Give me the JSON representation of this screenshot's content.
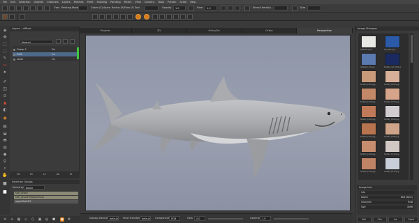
{
  "menu": [
    "File",
    "Edit",
    "Selection",
    "Objects",
    "Channels",
    "Layers",
    "Patches",
    "Paint",
    "Shading",
    "Painting",
    "Filters",
    "View",
    "Camera",
    "Tools",
    "Python",
    "Scale",
    "Help"
  ],
  "toolbar": {
    "mode_label": "Fast",
    "painting_mode_label": "Painting Mode",
    "colors_label": "Colors (C)",
    "alpha_label": "Alpha",
    "radius_label": "Radius (R)",
    "flow_label": "Flow (F)",
    "tool_label": "Tool",
    "opacity_label": "Opacity",
    "opacity_value": "1.0",
    "flow_value": "1.0",
    "flow2_label": "Flow",
    "stencil_label": "Stencil density",
    "size_label": "Size",
    "colors": {
      "accent_orange": "#d57a1a",
      "selection_blue": "#4d6a8a",
      "green_indicator": "#3fc83f"
    }
  },
  "layers_panel": {
    "title": "Layers - diffuse",
    "filter_value": "Normal",
    "layers": [
      {
        "name": "Group 1",
        "value": "On"
      },
      {
        "name": "RGB",
        "value": "On"
      },
      {
        "name": "Level",
        "value": "On"
      }
    ],
    "footer": [
      "Ne",
      "En",
      "Ln",
      "Ab",
      "Fe"
    ]
  },
  "selection_groups": {
    "title": "Selection Groups",
    "sorted_label": "Sorted by",
    "sorted_value": "Name",
    "items": [
      "skin_Shark",
      "skin_ShortFinMako/Shark",
      "upperTeethE1"
    ]
  },
  "viewport": {
    "tabs": [
      "Projects",
      "2D",
      "Ortho/2d",
      "Ortho",
      "Perspective"
    ],
    "active_tab": "Perspective",
    "background": "#9aa0b0"
  },
  "viewport_bar": {
    "display_device_label": "Display Device",
    "display_device_value": "default",
    "view_transform_label": "View Transform",
    "view_transform_value": "default",
    "component_label": "Component",
    "component_value": "RGB",
    "gain_label": "Gain",
    "gain_value": "0.0",
    "gamma_label": "Gamma",
    "gamma_value": "1.0"
  },
  "image_manager": {
    "title": "Image Manager",
    "thumbs": [
      {
        "label": "tiles2k01.jpg",
        "color": "#e8e8e4"
      },
      {
        "label": "sea_001.jpg",
        "color": "#2a5aa8"
      },
      {
        "label": "refShark_01.jpg",
        "color": "#5a7ab0"
      },
      {
        "label": "Soltalli_ref_1001.jpg",
        "color": "#1a2a60"
      },
      {
        "label": "Soltalli_1001.jpg",
        "color": "#c89a7a"
      },
      {
        "label": "Soltalli_1002.jpg",
        "color": "#d8b09a"
      },
      {
        "label": "Soltalli_1003.jpg",
        "color": "#c28868"
      },
      {
        "label": "Soltalli_1004.jpg",
        "color": "#d6a48a"
      },
      {
        "label": "Soltalli_1005.jpg",
        "color": "#c07a5a"
      },
      {
        "label": "Soltalli_1006.jpg",
        "color": "#d0ccd0"
      },
      {
        "label": "Soltalli_1007.jpg",
        "color": "#b8744e"
      },
      {
        "label": "Soltalli_1008.jpg",
        "color": "#cfa488"
      },
      {
        "label": "Soltalli_1009.jpg",
        "color": "#c68e6e"
      },
      {
        "label": "Soltalli_1010.jpg",
        "color": "#d2c8c4"
      },
      {
        "label": "Soltalli_1011.jpg",
        "color": "#bf8466"
      },
      {
        "label": "Soltalli_1012.jpg",
        "color": "#c9cfd8"
      }
    ],
    "info_title": "Image Info",
    "info": [
      {
        "label": "Info",
        "value": ""
      },
      {
        "label": "Depth",
        "value": "8bit (Byte)"
      },
      {
        "label": "Channels",
        "value": "RGB"
      },
      {
        "label": "Size",
        "value": "4096"
      }
    ],
    "buttons": [
      "Del",
      "Chk",
      "Ins",
      "Shell"
    ]
  }
}
